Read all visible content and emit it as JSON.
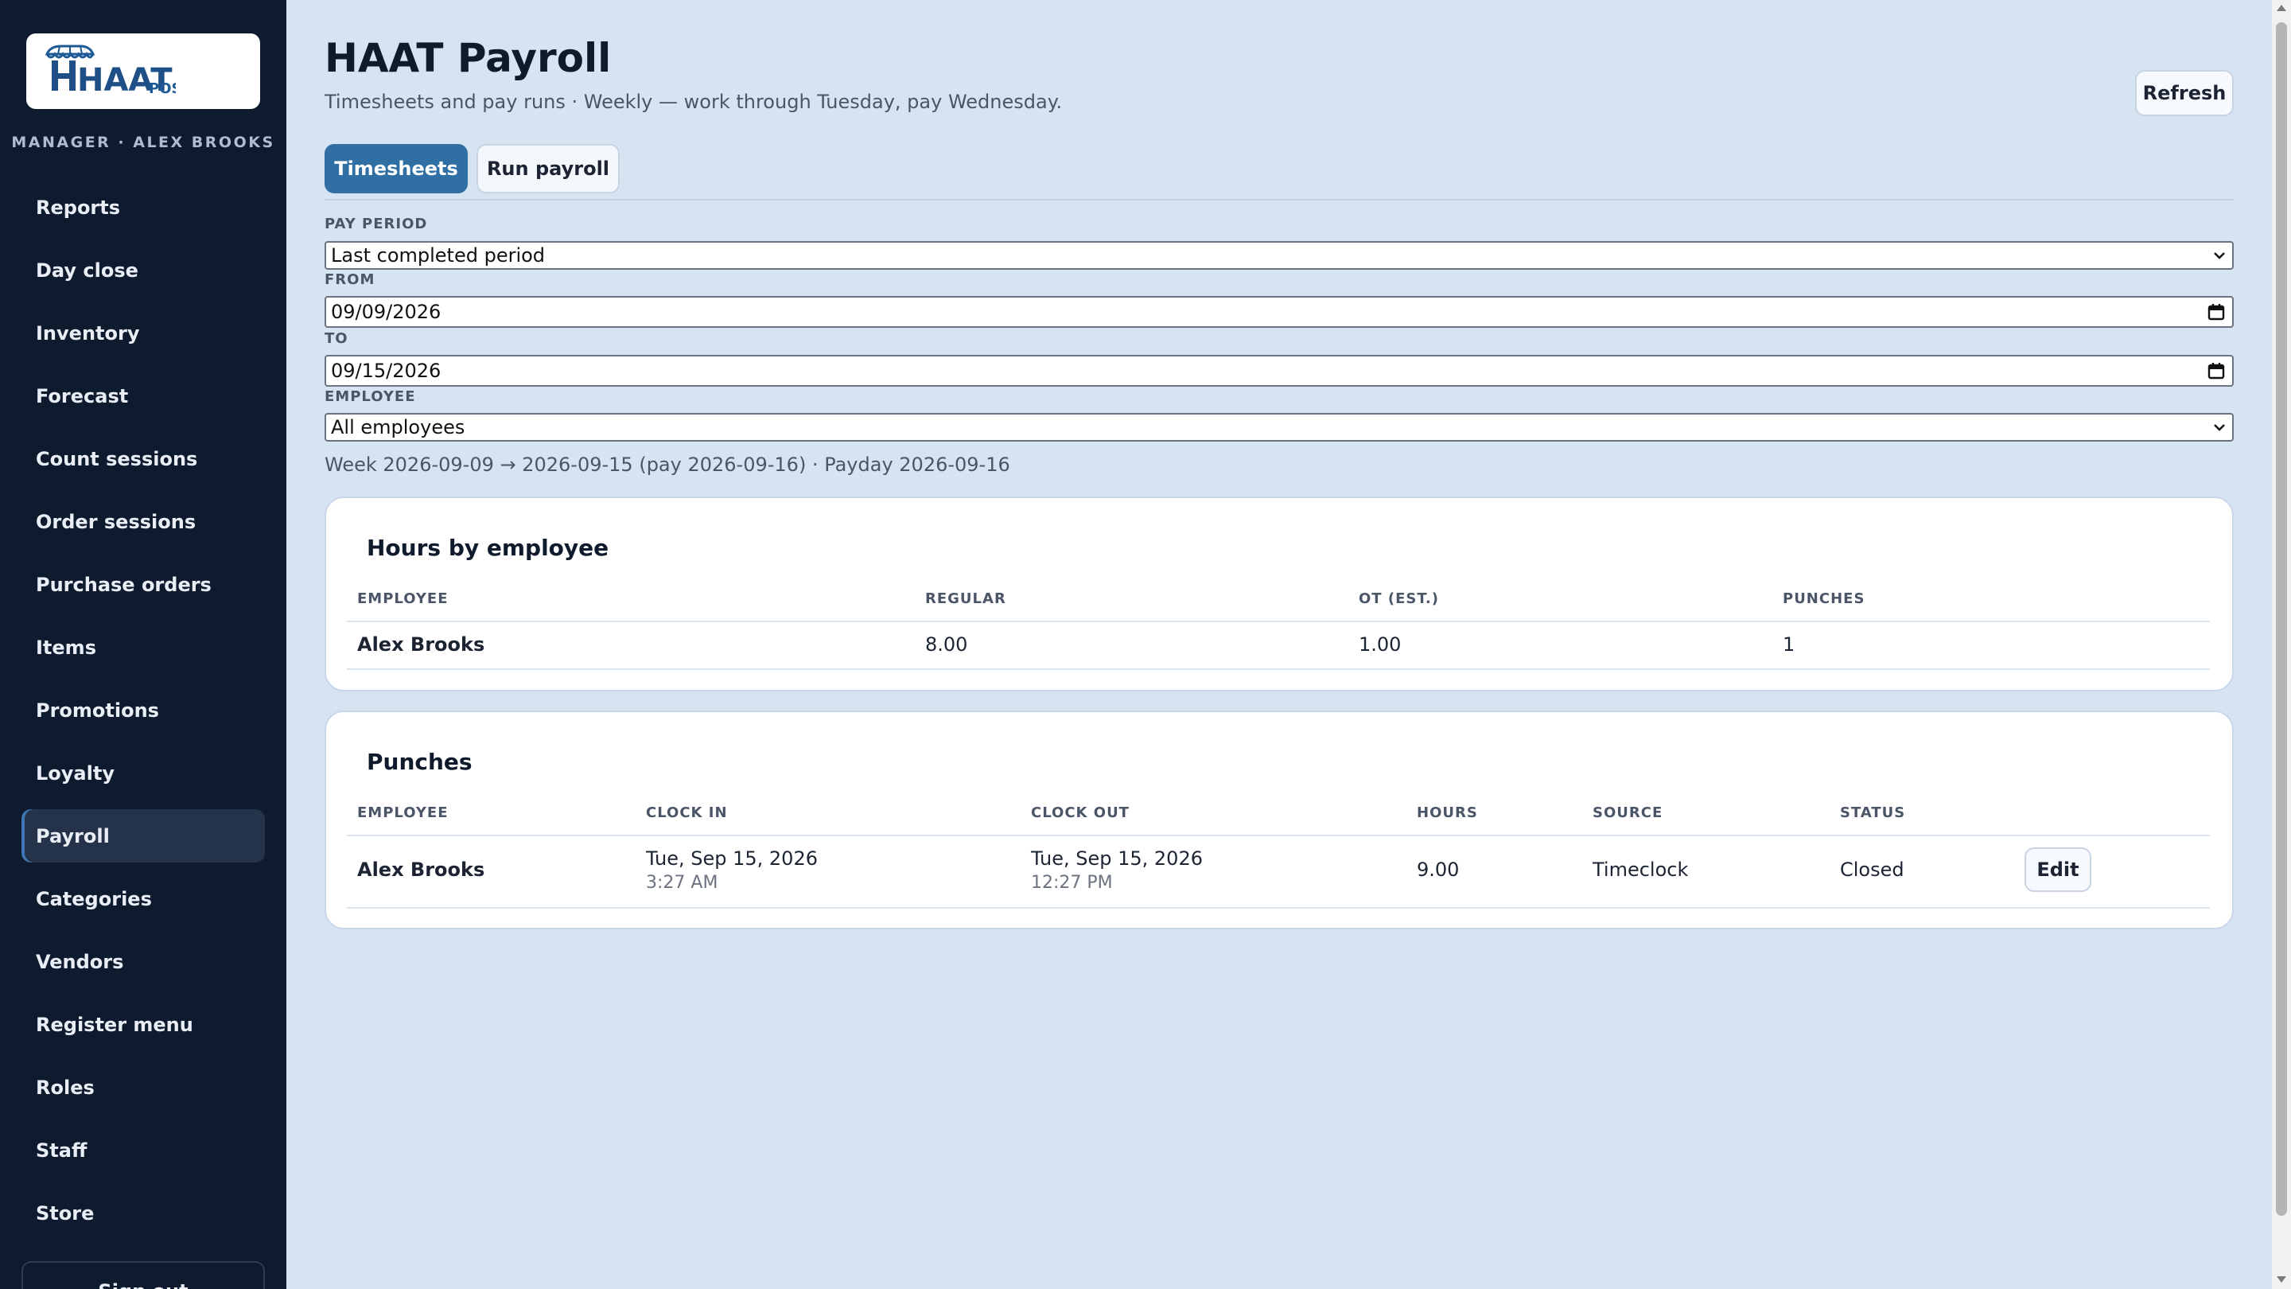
{
  "app": {
    "logo_text": "HAAT",
    "logo_sub": "POS",
    "role_line": "MANAGER · ALEX BROOKS"
  },
  "sidebar": {
    "items": [
      {
        "label": "Reports"
      },
      {
        "label": "Day close"
      },
      {
        "label": "Inventory"
      },
      {
        "label": "Forecast"
      },
      {
        "label": "Count sessions"
      },
      {
        "label": "Order sessions"
      },
      {
        "label": "Purchase orders"
      },
      {
        "label": "Items"
      },
      {
        "label": "Promotions"
      },
      {
        "label": "Loyalty"
      },
      {
        "label": "Payroll",
        "active": true
      },
      {
        "label": "Categories"
      },
      {
        "label": "Vendors"
      },
      {
        "label": "Register menu"
      },
      {
        "label": "Roles"
      },
      {
        "label": "Staff"
      },
      {
        "label": "Store"
      }
    ],
    "signout_label": "Sign out"
  },
  "header": {
    "title": "HAAT Payroll",
    "subtitle": "Timesheets and pay runs · Weekly — work through Tuesday, pay Wednesday.",
    "refresh_label": "Refresh"
  },
  "tabs": {
    "timesheets": "Timesheets",
    "run_payroll": "Run payroll",
    "active": "Timesheets"
  },
  "filters": {
    "pay_period_label": "PAY PERIOD",
    "pay_period_value": "Last completed period",
    "from_label": "FROM",
    "from_value": "09/09/2026",
    "to_label": "TO",
    "to_value": "09/15/2026",
    "employee_label": "EMPLOYEE",
    "employee_value": "All employees"
  },
  "week_line": "Week 2026-09-09 → 2026-09-15 (pay 2026-09-16) · Payday 2026-09-16",
  "hours_by_employee": {
    "title": "Hours by employee",
    "headers": {
      "employee": "EMPLOYEE",
      "regular": "REGULAR",
      "ot": "OT (EST.)",
      "punches": "PUNCHES"
    },
    "rows": [
      {
        "employee": "Alex Brooks",
        "regular": "8.00",
        "ot": "1.00",
        "punches": "1"
      }
    ]
  },
  "punches": {
    "title": "Punches",
    "headers": {
      "employee": "EMPLOYEE",
      "clock_in": "CLOCK IN",
      "clock_out": "CLOCK OUT",
      "hours": "HOURS",
      "source": "SOURCE",
      "status": "STATUS"
    },
    "rows": [
      {
        "employee": "Alex Brooks",
        "clock_in_date": "Tue, Sep 15, 2026",
        "clock_in_time": "3:27 AM",
        "clock_out_date": "Tue, Sep 15, 2026",
        "clock_out_time": "12:27 PM",
        "hours": "9.00",
        "source": "Timeclock",
        "status": "Closed",
        "action_label": "Edit"
      }
    ]
  },
  "colors": {
    "sidebar_bg": "#0e1b2e",
    "page_bg": "#d6e3f1",
    "accent": "#2f6fa3",
    "brand_blue": "#1e5a96"
  }
}
